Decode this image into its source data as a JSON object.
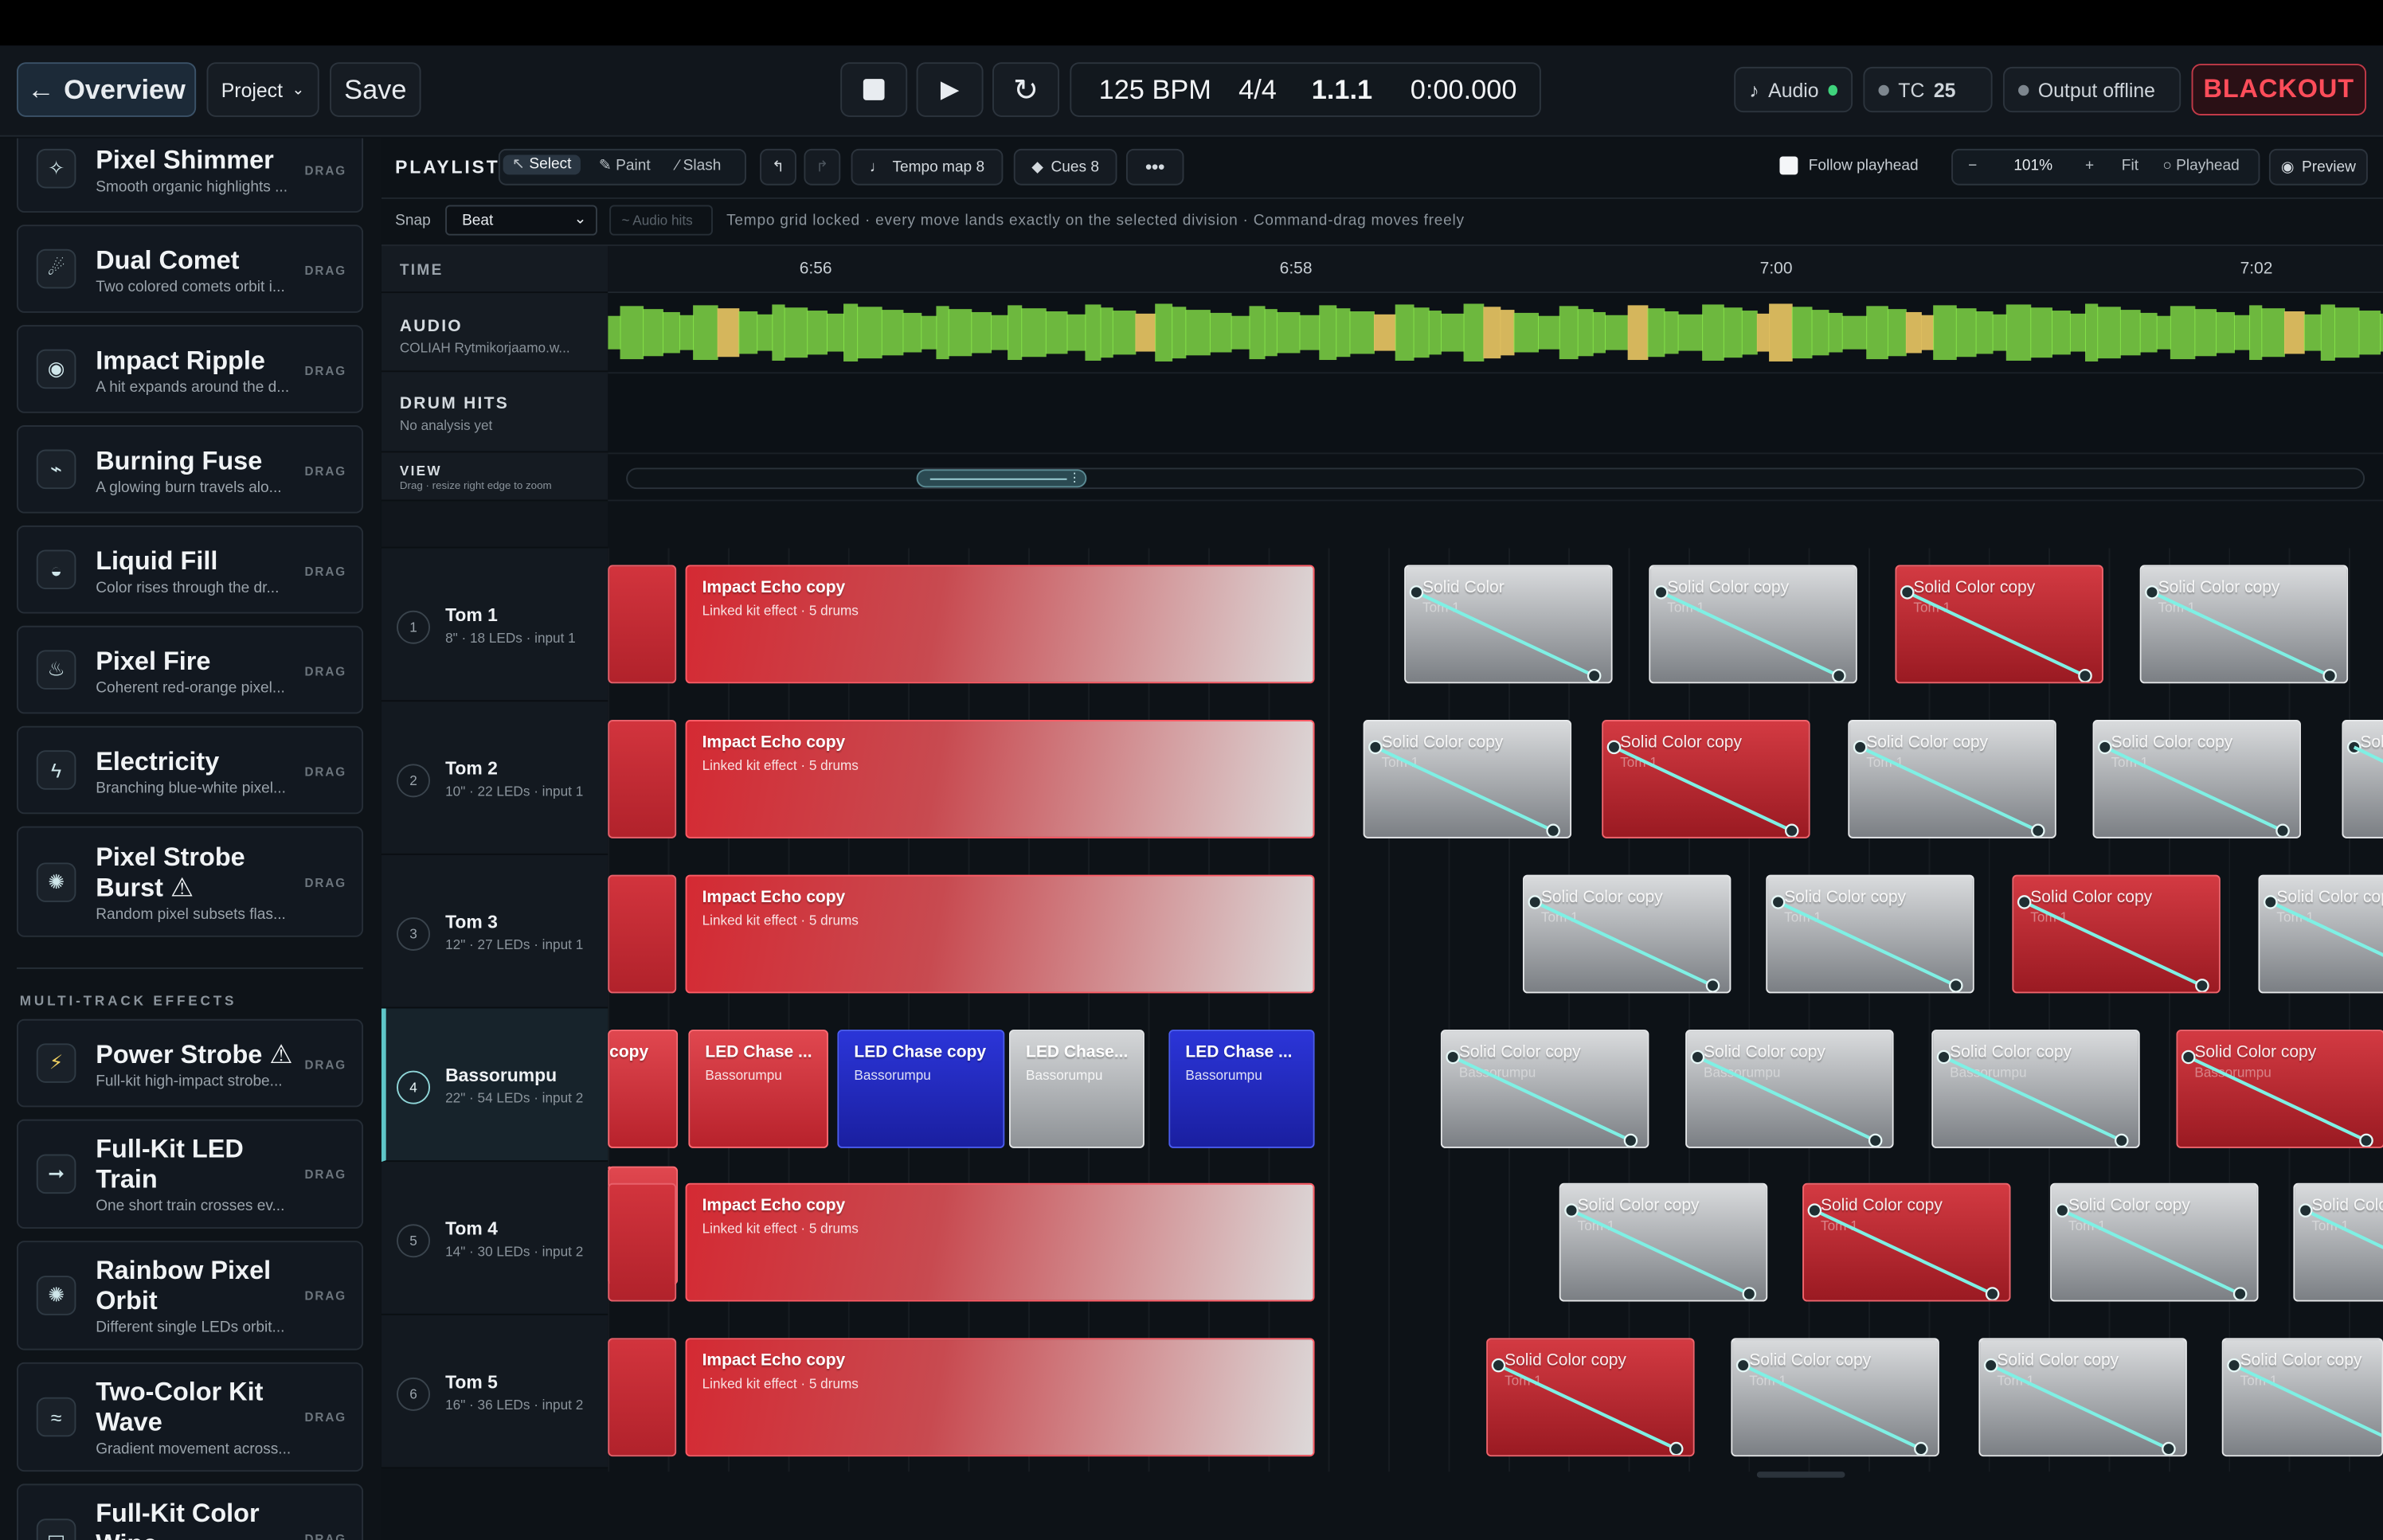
{
  "topbar": {
    "overview": "Overview",
    "project": "Project",
    "save": "Save",
    "bpm": "125 BPM",
    "time_signature": "4/4",
    "position": "1.1.1",
    "timecode": "0:00.000",
    "audio": "Audio",
    "tc_label": "TC",
    "tc_value": "25",
    "output": "Output offline",
    "blackout": "BLACKOUT",
    "colors": {
      "audio_dot": "#3fd37c",
      "blackout": "#ff4d5a"
    }
  },
  "sidebar": {
    "drag_label": "DRAG",
    "effects": [
      {
        "name": "Pixel Shimmer",
        "desc": "Smooth organic highlights ...",
        "icon": "sparkle-icon"
      },
      {
        "name": "Dual Comet",
        "desc": "Two colored comets orbit i...",
        "icon": "comet-icon"
      },
      {
        "name": "Impact Ripple",
        "desc": "A hit expands around the d...",
        "icon": "ripple-icon"
      },
      {
        "name": "Burning Fuse",
        "desc": "A glowing burn travels alo...",
        "icon": "fuse-icon"
      },
      {
        "name": "Liquid Fill",
        "desc": "Color rises through the dr...",
        "icon": "liquid-icon"
      },
      {
        "name": "Pixel Fire",
        "desc": "Coherent red-orange pixel...",
        "icon": "fire-icon"
      },
      {
        "name": "Electricity",
        "desc": "Branching blue-white pixel...",
        "icon": "lightning-icon"
      },
      {
        "name": "Pixel Strobe Burst",
        "desc": "Random pixel subsets flas...",
        "icon": "burst-icon",
        "warning": "⚠"
      }
    ],
    "multi_label": "MULTI-TRACK EFFECTS",
    "multi_effects": [
      {
        "name": "Power Strobe",
        "desc": "Full-kit high-impact strobe...",
        "icon": "power-icon",
        "warning": "⚠"
      },
      {
        "name": "Full-Kit LED Train",
        "desc": "One short train crosses ev...",
        "icon": "arrow-right-icon"
      },
      {
        "name": "Rainbow Pixel Orbit",
        "desc": "Different single LEDs orbit...",
        "icon": "orbit-icon"
      },
      {
        "name": "Two-Color Kit Wave",
        "desc": "Gradient movement across...",
        "icon": "wave-icon"
      },
      {
        "name": "Full-Kit Color Wipe",
        "desc": "",
        "icon": "wipe-icon"
      }
    ]
  },
  "playlist": {
    "title": "PLAYLIST",
    "tools": {
      "select": "Select",
      "paint": "Paint",
      "slash": "Slash"
    },
    "tempo_map": "Tempo map 8",
    "cues": "Cues 8",
    "follow_playhead": "Follow playhead",
    "zoom": "101%",
    "zoom_minus": "−",
    "zoom_plus": "+",
    "fit": "Fit",
    "playhead": "Playhead",
    "preview": "Preview",
    "snap_label": "Snap",
    "snap_value": "Beat",
    "audio_hits": "~ Audio hits",
    "hint": "Tempo grid locked · every move lands exactly on the selected division · Command-drag moves freely",
    "time_label": "TIME",
    "ticks": [
      "6:56",
      "6:58",
      "7:00",
      "7:02"
    ],
    "audio_label": "AUDIO",
    "audio_file": "COLIAH Rytmikorjaamo.w...",
    "drum_label": "DRUM HITS",
    "drum_status": "No analysis yet",
    "view_label": "VIEW",
    "view_hint": "Drag · resize right edge to zoom",
    "colors": {
      "waveform": "#8ef04c",
      "waveform_peak": "#e0c060",
      "accent": "#5fc6c8"
    }
  },
  "tracks": [
    {
      "num": "1",
      "name": "Tom 1",
      "sub": "8\" · 18 LEDs · input 1"
    },
    {
      "num": "2",
      "name": "Tom 2",
      "sub": "10\" · 22 LEDs · input 1"
    },
    {
      "num": "3",
      "name": "Tom 3",
      "sub": "12\" · 27 LEDs · input 1"
    },
    {
      "num": "4",
      "name": "Bassorumpu",
      "sub": "22\" · 54 LEDs · input 2",
      "selected": true
    },
    {
      "num": "5",
      "name": "Tom 4",
      "sub": "14\" · 30 LEDs · input 2"
    },
    {
      "num": "6",
      "name": "Tom 5",
      "sub": "16\" · 36 LEDs · input 2"
    }
  ],
  "clips": {
    "impact_title": "Impact Echo copy",
    "impact_sub": "Linked kit effect · 5 drums",
    "copy_stub": "copy",
    "solid_title": "Solid Color copy",
    "solid_title_first": "Solid Color",
    "led_chase_trunc": "LED Chase ...",
    "led_chase": "LED Chase copy",
    "led_chase_trunc2": "LED Chase...",
    "basso": "Bassorumpu",
    "tom_sub": "Tom 1",
    "basso_sub": "Bassorumpu"
  }
}
